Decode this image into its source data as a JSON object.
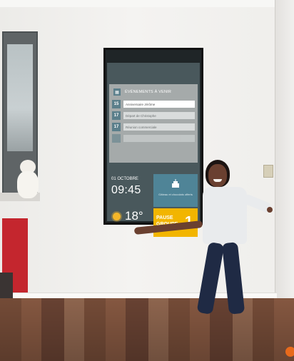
{
  "screen": {
    "events_title": "ÉVÉNEMENTS À VENIR",
    "events": [
      {
        "day": "15",
        "text": "Anniversaire Jérôme"
      },
      {
        "day": "17",
        "text": "Départ de Christophe"
      },
      {
        "day": "17",
        "text": "Réunion commerciale"
      },
      {
        "day": "",
        "text": ""
      }
    ],
    "date": "01 OCTOBRE",
    "time": "09:45",
    "temperature": "18°",
    "info_text": "Gâteau et chocolats offerts",
    "pause_line1": "PAUSE",
    "pause_line2": "GROUPE",
    "pause_number": "1"
  },
  "colors": {
    "screen_bg": "#49585c",
    "accent_yellow": "#f2b500",
    "accent_blue": "#4f8497",
    "panel_grey": "#a5aaaa"
  },
  "icons": [
    "calendar-icon",
    "sun-icon",
    "cake-icon"
  ]
}
